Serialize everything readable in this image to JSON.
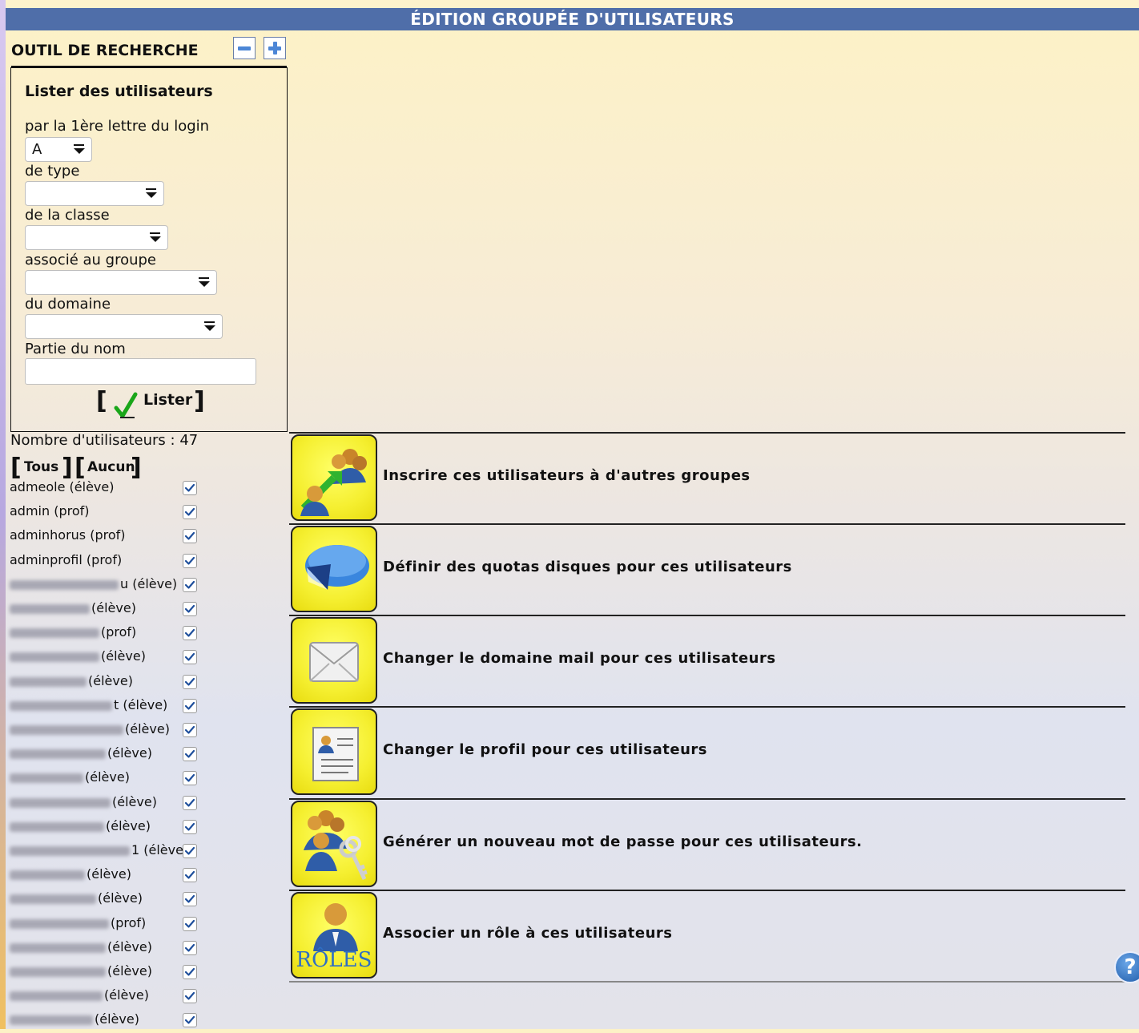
{
  "page": {
    "title": "ÉDITION GROUPÉE D'UTILISATEURS"
  },
  "search": {
    "title": "OUTIL DE RECHERCHE",
    "heading": "Lister des utilisateurs",
    "first_letter_label": "par la 1ère lettre du login",
    "first_letter_value": "A",
    "type_label": "de type",
    "type_value": "",
    "class_label": "de la classe",
    "class_value": "",
    "group_label": "associé au groupe",
    "group_value": "",
    "domain_label": "du domaine",
    "domain_value": "",
    "name_label": "Partie du nom",
    "name_value": "",
    "submit_label": "Lister",
    "collapse_icon": "minus-icon",
    "expand_icon": "plus-icon"
  },
  "results": {
    "count_text": "Nombre d'utilisateurs : 47",
    "select_all_label": "Tous",
    "select_none_label": "Aucun",
    "users": [
      {
        "name": "admeole (élève)",
        "checked": true
      },
      {
        "name": "admin (prof)",
        "checked": true
      },
      {
        "name": "adminhorus (prof)",
        "checked": true
      },
      {
        "name": "adminprofil (prof)",
        "checked": true
      },
      {
        "name": "u (élève)",
        "checked": true
      },
      {
        "name": "(élève)",
        "checked": true
      },
      {
        "name": "(prof)",
        "checked": true
      },
      {
        "name": "(élève)",
        "checked": true
      },
      {
        "name": "(élève)",
        "checked": true
      },
      {
        "name": "t (élève)",
        "checked": true
      },
      {
        "name": "(élève)",
        "checked": true
      },
      {
        "name": "(élève)",
        "checked": true
      },
      {
        "name": "(élève)",
        "checked": true
      },
      {
        "name": "(élève)",
        "checked": true
      },
      {
        "name": "(élève)",
        "checked": true
      },
      {
        "name": "1 (élève)",
        "checked": true
      },
      {
        "name": "(élève)",
        "checked": true
      },
      {
        "name": "(élève)",
        "checked": true
      },
      {
        "name": "(prof)",
        "checked": true
      },
      {
        "name": "(élève)",
        "checked": true
      },
      {
        "name": "(élève)",
        "checked": true
      },
      {
        "name": "(élève)",
        "checked": true
      },
      {
        "name": "(élève)",
        "checked": true
      }
    ]
  },
  "actions": [
    {
      "label": "Inscrire ces utilisateurs à d'autres groupes",
      "icon": "users-group-arrow-icon"
    },
    {
      "label": "Définir des quotas disques pour ces utilisateurs",
      "icon": "disk-quota-icon"
    },
    {
      "label": "Changer le domaine mail pour ces utilisateurs",
      "icon": "mail-envelope-icon"
    },
    {
      "label": "Changer le profil pour ces utilisateurs",
      "icon": "profile-document-icon"
    },
    {
      "label": "Générer un nouveau mot de passe pour ces utilisateurs.",
      "icon": "users-keys-icon"
    },
    {
      "label": "Associer un rôle à ces utilisateurs",
      "icon": "roles-user-icon",
      "icon_text": "RÔLES"
    }
  ],
  "help": {
    "icon": "help-icon",
    "symbol": "?"
  },
  "colors": {
    "title_bar": "#4f6ea9",
    "action_icon_bg": "#f5ef30",
    "checkbox_check": "#1f4f9c"
  }
}
